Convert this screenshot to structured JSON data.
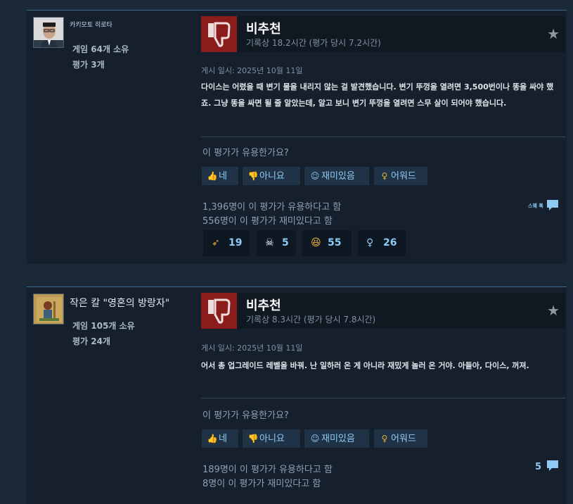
{
  "reviews": [
    {
      "author": {
        "name": "카키모토 히로타",
        "games_owned": "게임 64개 소유",
        "reviews": "평가 3개"
      },
      "verdict": "비추천",
      "hours": "기록상 18.2시간 (평가 당시 7.2시간)",
      "posted": "게시 일시: 2025년 10월 11일",
      "body": "다이스는 어렸을 때 변기 물을 내리지 않는 걸 발견했습니다. 변기 뚜껑을 열려면 3,500번이나 똥을 싸야 했죠. 그냥 똥을 싸면 될 줄 알았는데, 알고 보니 변기 뚜껑을 열려면 스무 살이 되어야 했습니다.",
      "helpful_question": "이 평가가 유용한가요?",
      "buttons": {
        "yes": "네",
        "no": "아니요",
        "funny": "재미있음",
        "award": "어워드"
      },
      "helpful_count": "1,396명이 이 평가가 유용하다고 함",
      "funny_count": "556명이 이 평가가 재미있다고 함",
      "comments_label": "스웨 톡",
      "reactions": [
        {
          "icon": "sword-icon",
          "count": "19"
        },
        {
          "icon": "winged-skull-icon",
          "count": "5"
        },
        {
          "icon": "laughing-face-icon",
          "count": "55"
        },
        {
          "icon": "award-ribbon-icon",
          "count": "26"
        }
      ]
    },
    {
      "author": {
        "name": "작은 칼 \"영혼의 방랑자\"",
        "games_owned": "게임 105개 소유",
        "reviews": "평가 24개"
      },
      "verdict": "비추천",
      "hours": "기록상 8.3시간 (평가 당시 7.8시간)",
      "posted": "게시 일시: 2025년 10월 11일",
      "body": "어서 총 업그레이드 레벨을 바꿔. 난 일하러 온 게 아니라 재밌게 놀러 온 거야. 아들아, 다이스, 꺼져.",
      "helpful_question": "이 평가가 유용한가요?",
      "buttons": {
        "yes": "네",
        "no": "아니요",
        "funny": "재미있음",
        "award": "어워드"
      },
      "helpful_count": "189명이 이 평가가 유용하다고 함",
      "funny_count": "8명이 이 평가가 재미있다고 함",
      "comments_count": "5"
    }
  ],
  "colors": {
    "background": "#1b2838",
    "thumb_down": "#8b1c1c",
    "accent_blue": "#8ecaf4"
  }
}
